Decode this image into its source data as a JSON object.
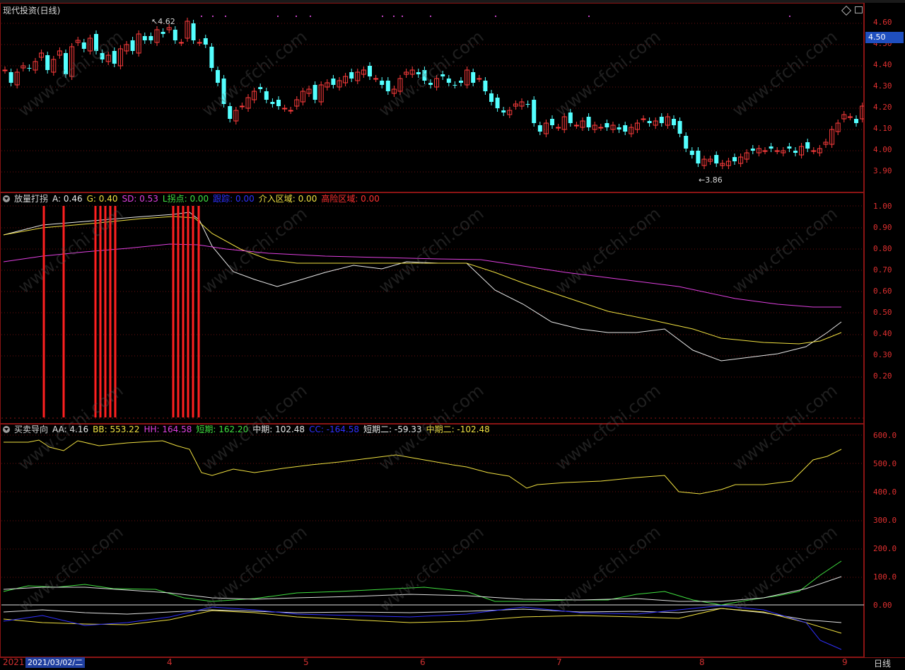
{
  "main_panel": {
    "title": "现代投资(日线)",
    "price_flag": "4.50",
    "high_label": "4.62",
    "low_label": "3.86",
    "yticks": [
      "4.60",
      "4.50",
      "4.40",
      "4.30",
      "4.20",
      "4.10",
      "4.00",
      "3.90"
    ]
  },
  "ind1": {
    "name": "放量打拐",
    "params": [
      {
        "label": "A:",
        "value": "0.46",
        "color": "#e8e8e8"
      },
      {
        "label": "G:",
        "value": "0.40",
        "color": "#f0e040"
      },
      {
        "label": "SD:",
        "value": "0.53",
        "color": "#e040e0"
      },
      {
        "label": "L拐点:",
        "value": "0.00",
        "color": "#40e040"
      },
      {
        "label": "跟踪:",
        "value": "0.00",
        "color": "#3030ff"
      },
      {
        "label": "介入区域:",
        "value": "0.00",
        "color": "#f0e040"
      },
      {
        "label": "高险区域:",
        "value": "0.00",
        "color": "#ff3030"
      }
    ],
    "yticks": [
      "1.00",
      "0.90",
      "0.80",
      "0.70",
      "0.60",
      "0.50",
      "0.40",
      "0.30",
      "0.20"
    ]
  },
  "ind2": {
    "name": "买卖导向",
    "params": [
      {
        "label": "AA:",
        "value": "4.16",
        "color": "#e8e8e8"
      },
      {
        "label": "BB:",
        "value": "553.22",
        "color": "#f0e040"
      },
      {
        "label": "HH:",
        "value": "164.58",
        "color": "#e040e0"
      },
      {
        "label": "短期:",
        "value": "162.20",
        "color": "#40e040"
      },
      {
        "label": "中期:",
        "value": "102.48",
        "color": "#e8e8e8"
      },
      {
        "label": "CC:",
        "value": "-164.58",
        "color": "#3030ff"
      },
      {
        "label": "短期二:",
        "value": "-59.33",
        "color": "#e8e8e8"
      },
      {
        "label": "中期二:",
        "value": "-102.48",
        "color": "#f0e040"
      }
    ],
    "yticks": [
      "600.0",
      "500.0",
      "400.0",
      "300.0",
      "200.0",
      "100.0",
      "0.00"
    ]
  },
  "xaxis": {
    "year": "2021",
    "cursor_date": "2021/03/02/二",
    "months": [
      "4",
      "5",
      "6",
      "7",
      "8",
      "9"
    ],
    "period": "日线"
  },
  "watermark": "www.cfchi.com",
  "colors": {
    "up": "#ff3c3c",
    "down": "#54ffff",
    "frame": "#8a1414"
  }
}
